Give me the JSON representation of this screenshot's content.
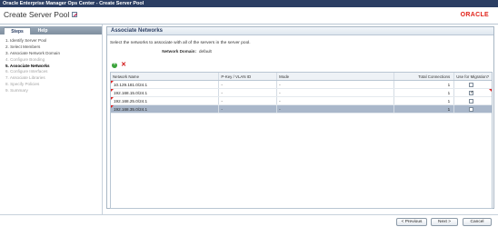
{
  "window": {
    "title": "Oracle Enterprise Manager Ops Center - Create Server Pool"
  },
  "header": {
    "title": "Create Server Pool",
    "logo": "ORACLE",
    "title_icon": "pencil-edit-icon"
  },
  "sidebar": {
    "tabs": [
      {
        "label": "Steps",
        "active": true
      },
      {
        "label": "Help",
        "active": false
      }
    ],
    "steps": [
      {
        "label": "1. Identify Server Pool",
        "state": "done"
      },
      {
        "label": "2. Select Members",
        "state": "done"
      },
      {
        "label": "3. Associate Network Domain",
        "state": "done"
      },
      {
        "label": "4. Configure Bonding",
        "state": "future"
      },
      {
        "label": "5. Associate Networks",
        "state": "current"
      },
      {
        "label": "6. Configure Interfaces",
        "state": "future"
      },
      {
        "label": "7. Associate Libraries",
        "state": "future"
      },
      {
        "label": "8. Specify Policies",
        "state": "future"
      },
      {
        "label": "9. Summary",
        "state": "future"
      }
    ]
  },
  "panel": {
    "title": "Associate Networks",
    "instruction": "Select the networks to associate with all of the servers in the server pool.",
    "network_domain_label": "Network Domain:",
    "network_domain_value": "default",
    "toolbar": {
      "add_icon": "plus-circle-icon",
      "remove_icon": "x-delete-icon"
    },
    "table": {
      "columns": [
        "Network Name",
        "P-Key / VLAN ID",
        "Mode",
        "Total Connections",
        "Use for Migration?"
      ],
      "rows": [
        {
          "name": "10.129.181.0/24.1",
          "pkey": "-",
          "mode": "-",
          "connections": "1",
          "migration": false,
          "selected": false
        },
        {
          "name": "192.168.15.0/24.1",
          "pkey": "-",
          "mode": "-",
          "connections": "1",
          "migration": true,
          "selected": false
        },
        {
          "name": "192.168.25.0/24.1",
          "pkey": "-",
          "mode": "-",
          "connections": "1",
          "migration": false,
          "selected": false
        },
        {
          "name": "192.168.35.0/24.1",
          "pkey": "-",
          "mode": "-",
          "connections": "1",
          "migration": false,
          "selected": true
        }
      ]
    }
  },
  "footer": {
    "previous_label": "< Previous",
    "next_label": "Next >",
    "cancel_label": "Cancel"
  }
}
